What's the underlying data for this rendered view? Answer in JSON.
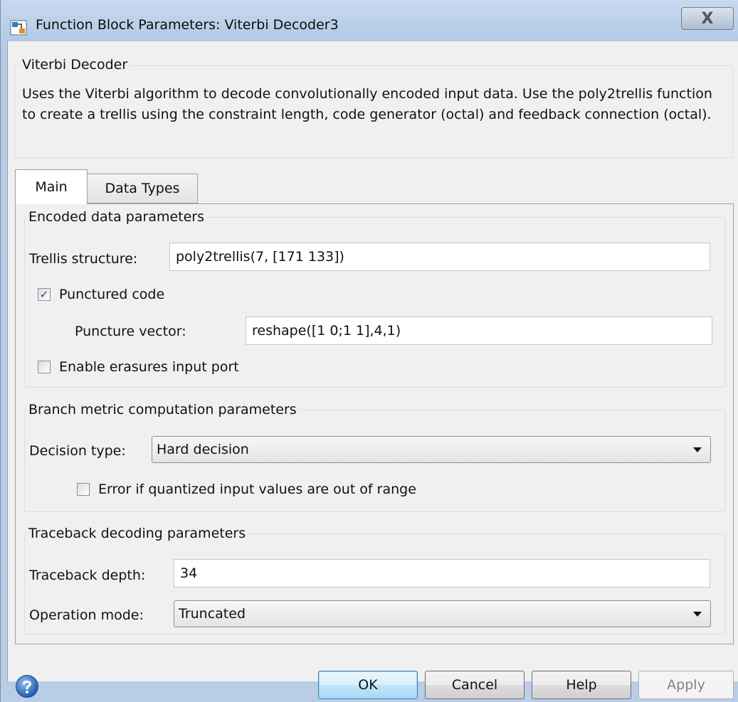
{
  "window": {
    "title": "Function Block Parameters: Viterbi Decoder3",
    "close_glyph": "X"
  },
  "description_group": {
    "title": "Viterbi Decoder",
    "text": "Uses the Viterbi algorithm to decode convolutionally encoded input data.  Use the poly2trellis function to create a trellis using the constraint length, code generator (octal) and feedback connection (octal)."
  },
  "tabs": [
    {
      "label": "Main",
      "selected": true
    },
    {
      "label": "Data Types",
      "selected": false
    }
  ],
  "encoded": {
    "title": "Encoded data parameters",
    "trellis_label": "Trellis structure:",
    "trellis_value": "poly2trellis(7, [171 133])",
    "punctured_label": "Punctured code",
    "punctured_checked": true,
    "puncture_vector_label": "Puncture vector:",
    "puncture_vector_value": "reshape([1 0;1 1],4,1)",
    "erasures_label": "Enable erasures input port",
    "erasures_checked": false
  },
  "branch": {
    "title": "Branch metric computation parameters",
    "decision_label": "Decision type:",
    "decision_value": "Hard decision",
    "error_label": "Error if quantized input values are out of range",
    "error_checked": false
  },
  "traceback": {
    "title": "Traceback decoding parameters",
    "depth_label": "Traceback depth:",
    "depth_value": "34",
    "mode_label": "Operation mode:",
    "mode_value": "Truncated"
  },
  "buttons": {
    "ok": "OK",
    "cancel": "Cancel",
    "help": "Help",
    "apply": "Apply"
  },
  "icons": {
    "title": "simulink-block-icon",
    "help": "help-question-icon",
    "check": "✓"
  }
}
